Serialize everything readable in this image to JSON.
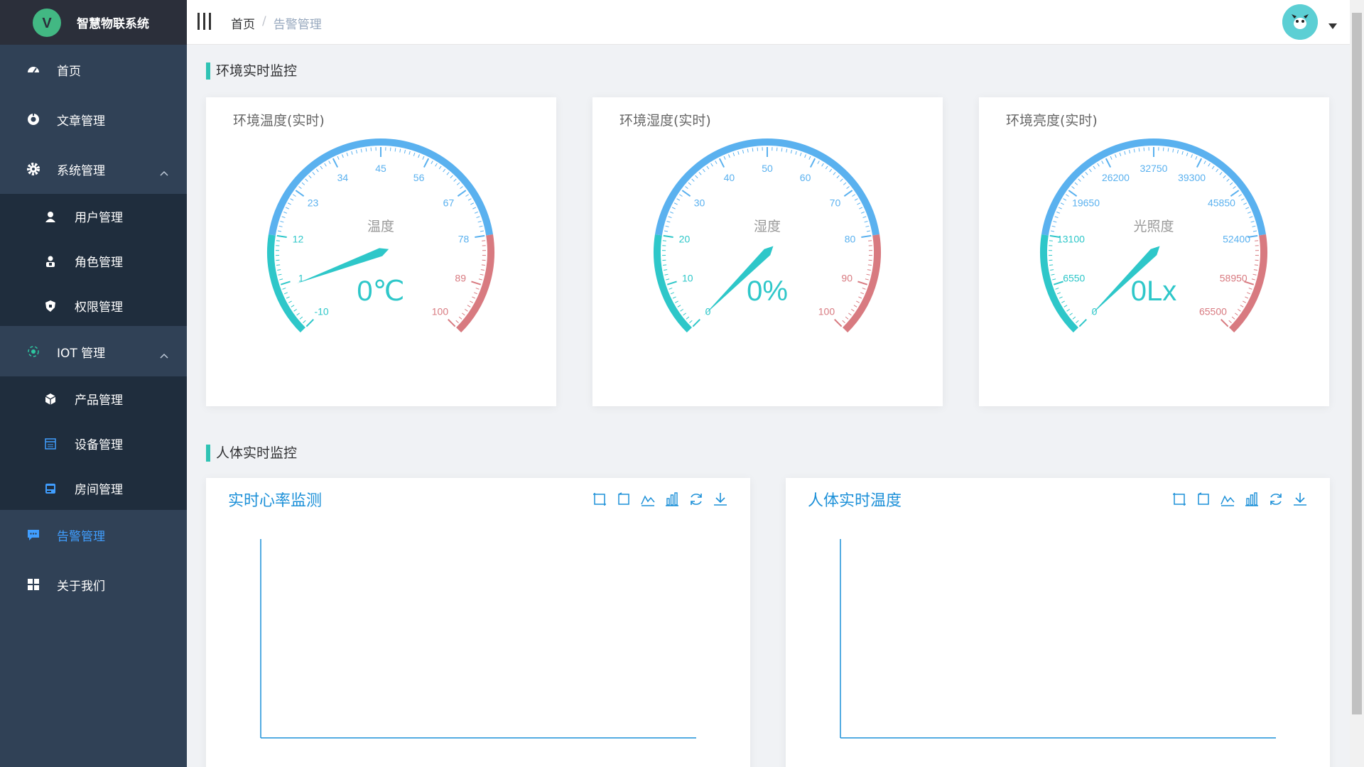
{
  "app": {
    "title": "智慧物联系统",
    "logo_letter": "V"
  },
  "sidebar": {
    "items": [
      {
        "label": "首页",
        "icon": "dashboard-icon"
      },
      {
        "label": "文章管理",
        "icon": "article-icon"
      },
      {
        "label": "系统管理",
        "icon": "gear-icon",
        "expanded": true,
        "children": [
          {
            "label": "用户管理",
            "icon": "user-icon"
          },
          {
            "label": "角色管理",
            "icon": "role-icon"
          },
          {
            "label": "权限管理",
            "icon": "shield-icon"
          }
        ]
      },
      {
        "label": "IOT 管理",
        "icon": "iot-icon",
        "expanded": true,
        "children": [
          {
            "label": "产品管理",
            "icon": "product-icon"
          },
          {
            "label": "设备管理",
            "icon": "device-icon"
          },
          {
            "label": "房间管理",
            "icon": "room-icon"
          }
        ]
      },
      {
        "label": "告警管理",
        "icon": "chat-icon",
        "active": true
      },
      {
        "label": "关于我们",
        "icon": "grid-icon"
      }
    ]
  },
  "header": {
    "breadcrumb": {
      "home": "首页",
      "separator": "/",
      "current": "告警管理"
    }
  },
  "sections": {
    "env": "环境实时监控",
    "body": "人体实时监控"
  },
  "gauges": [
    {
      "title": "环境温度(实时)",
      "name": "温度",
      "value": 0,
      "unit": "℃",
      "display": "0℃",
      "min": -10,
      "max": 100,
      "ticks": [
        "-10",
        "1",
        "12",
        "23",
        "34",
        "45",
        "56",
        "67",
        "78",
        "89",
        "100"
      ]
    },
    {
      "title": "环境湿度(实时)",
      "name": "湿度",
      "value": 0,
      "unit": "%",
      "display": "0%",
      "min": 0,
      "max": 100,
      "ticks": [
        "0",
        "10",
        "20",
        "30",
        "40",
        "50",
        "60",
        "70",
        "80",
        "90",
        "100"
      ]
    },
    {
      "title": "环境亮度(实时)",
      "name": "光照度",
      "value": 0,
      "unit": "Lx",
      "display": "0Lx",
      "min": 0,
      "max": 65500,
      "ticks": [
        "0",
        "6550",
        "13100",
        "19650",
        "26200",
        "32750",
        "39300",
        "45850",
        "52400",
        "58950",
        "65500"
      ]
    }
  ],
  "charts": [
    {
      "title": "实时心率监测"
    },
    {
      "title": "人体实时温度"
    }
  ],
  "toolbox": [
    "zoom-icon",
    "zoom-reset-icon",
    "line-chart-icon",
    "bar-chart-icon",
    "restore-icon",
    "download-icon"
  ],
  "colors": {
    "sidebar": "#304156",
    "submenu": "#1f2d3d",
    "active": "#409eff",
    "gauge_low": "#2ec7c9",
    "gauge_mid": "#5ab1ef",
    "gauge_high": "#d87a80",
    "accent": "#2fc3b4"
  },
  "chart_data": [
    {
      "type": "line",
      "title": "实时心率监测",
      "x": [],
      "series": []
    },
    {
      "type": "line",
      "title": "人体实时温度",
      "x": [],
      "series": []
    }
  ]
}
